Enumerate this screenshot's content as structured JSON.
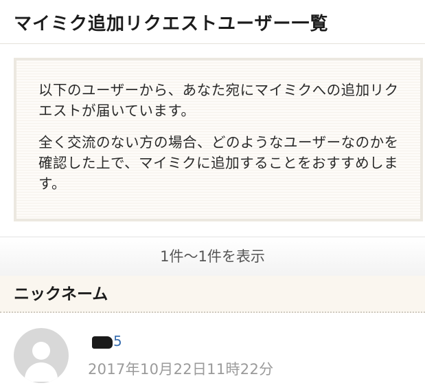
{
  "page": {
    "title": "マイミク追加リクエストユーザー一覧"
  },
  "notice": {
    "paragraph_1": "以下のユーザーから、あなた宛にマイミクへの追加リクエストが届いています。",
    "paragraph_2": "全く交流のない方の場合、どのようなユーザーなのかを確認した上で、マイミクに追加することをおすすめします。"
  },
  "results": {
    "summary": "1件〜1件を表示"
  },
  "list": {
    "header": "ニックネーム",
    "items": [
      {
        "nickname_visible": "5",
        "date": "2017年10月22日11時22分",
        "avatar_icon": "default-user-icon"
      }
    ]
  }
}
